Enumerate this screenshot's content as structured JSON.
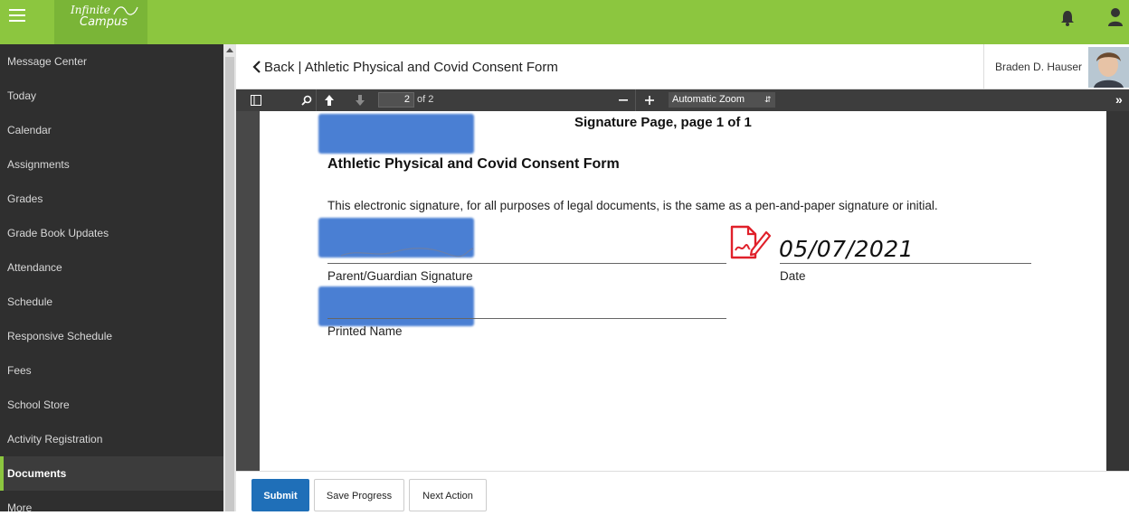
{
  "app": {
    "logo_line1": "Infinite",
    "logo_line2": "Campus",
    "brand_color": "#8cc63f"
  },
  "sidebar": {
    "items": [
      {
        "label": "Message Center"
      },
      {
        "label": "Today"
      },
      {
        "label": "Calendar"
      },
      {
        "label": "Assignments"
      },
      {
        "label": "Grades"
      },
      {
        "label": "Grade Book Updates"
      },
      {
        "label": "Attendance"
      },
      {
        "label": "Schedule"
      },
      {
        "label": "Responsive Schedule"
      },
      {
        "label": "Fees"
      },
      {
        "label": "School Store"
      },
      {
        "label": "Activity Registration"
      },
      {
        "label": "Documents",
        "active": true
      },
      {
        "label": "More"
      }
    ]
  },
  "header": {
    "back_title": "Back | Athletic Physical and Covid Consent Form",
    "user_name": "Braden D. Hauser"
  },
  "pdf_toolbar": {
    "page_number": "2",
    "page_total": "of 2",
    "zoom": "Automatic Zoom"
  },
  "document": {
    "heading": "Signature Page, page 1 of 1",
    "form_title": "Athletic Physical and Covid Consent Form",
    "statement": "This electronic signature, for all purposes of legal documents, is the same as a pen-and-paper signature or initial.",
    "signature_label": "Parent/Guardian Signature",
    "date_label": "Date",
    "date_value": "05/07/2021",
    "printed_name_label": "Printed Name"
  },
  "footer": {
    "submit": "Submit",
    "save_progress": "Save Progress",
    "next_action": "Next Action"
  }
}
